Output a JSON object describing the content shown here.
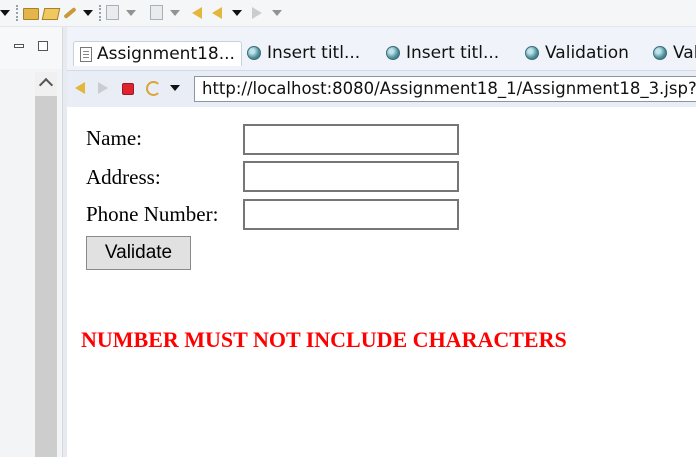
{
  "toolbar": {
    "icons": [
      "new-folder-icon",
      "open-folder-icon",
      "run-wand-icon",
      "dropdown-caret-icon",
      "import-icon",
      "export-icon",
      "back-icon",
      "history-back-icon",
      "forward-icon"
    ]
  },
  "tabs": [
    {
      "label": "Assignment18...",
      "icon": "document-icon",
      "active": true
    },
    {
      "label": "Insert titl...",
      "icon": "globe-icon",
      "active": false
    },
    {
      "label": "Insert titl...",
      "icon": "globe-icon",
      "active": false
    },
    {
      "label": "Validation",
      "icon": "globe-icon",
      "active": false
    },
    {
      "label": "Val",
      "icon": "globe-icon",
      "active": false
    }
  ],
  "browser": {
    "url": "http://localhost:8080/Assignment18_1/Assignment18_3.jsp?na"
  },
  "form": {
    "name_label": "Name:",
    "name_value": "",
    "address_label": "Address:",
    "address_value": "",
    "phone_label": "Phone Number:",
    "phone_value": "",
    "validate_label": "Validate"
  },
  "message": {
    "error": "NUMBER MUST NOT INCLUDE CHARACTERS",
    "color": "#ff0000"
  }
}
